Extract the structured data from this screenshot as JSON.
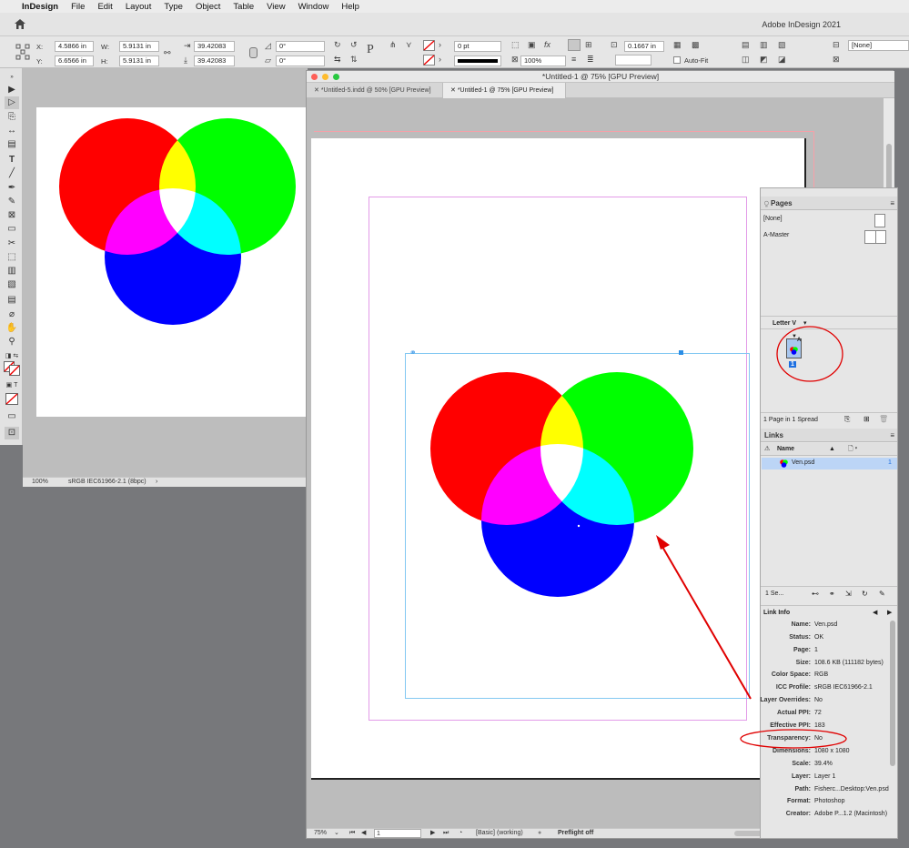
{
  "menubar": {
    "apple": "",
    "app": "InDesign",
    "items": [
      "File",
      "Edit",
      "Layout",
      "Type",
      "Object",
      "Table",
      "View",
      "Window",
      "Help"
    ]
  },
  "appbar": {
    "title": "Adobe InDesign 2021"
  },
  "control": {
    "x_label": "X:",
    "x_value": "4.5866 in",
    "y_label": "Y:",
    "y_value": "6.6566 in",
    "w_label": "W:",
    "w_value": "5.9131 in",
    "h_label": "H:",
    "h_value": "5.9131 in",
    "scale_x": "39.42083",
    "scale_y": "39.42083",
    "rotate": "0°",
    "shear": "0°",
    "stroke_weight": "0 pt",
    "opacity": "100%",
    "fit_value": "0.1667 in",
    "auto_fit": "Auto-Fit",
    "style": "[None]"
  },
  "window1": {
    "zoom": "100%",
    "profile": "sRGB IEC61966-2.1 (8bpc)"
  },
  "window2": {
    "title": "*Untitled-1 @ 75% [GPU Preview]",
    "tabs": [
      "*Untitled-5.indd @ 50% [GPU Preview]",
      "*Untitled-1 @ 75% [GPU Preview]"
    ],
    "zoom": "75%",
    "page": "1",
    "style_state": "[Basic] (working)",
    "preflight": "Preflight off"
  },
  "pages_panel": {
    "title": "Pages",
    "none": "[None]",
    "master": "A-Master",
    "size": "Letter V",
    "page_number": "1",
    "master_letter": "A",
    "summary": "1 Page in 1 Spread"
  },
  "links_panel": {
    "title": "Links",
    "col_name": "Name",
    "file": "Ven.psd",
    "selection": "1 Se...",
    "info_title": "Link Info",
    "info": [
      {
        "k": "Name:",
        "v": "Ven.psd"
      },
      {
        "k": "Status:",
        "v": "OK"
      },
      {
        "k": "Page:",
        "v": "1"
      },
      {
        "k": "Size:",
        "v": "108.6 KB (111182 bytes)"
      },
      {
        "k": "Color Space:",
        "v": "RGB"
      },
      {
        "k": "ICC Profile:",
        "v": "sRGB IEC61966-2.1"
      },
      {
        "k": "Layer Overrides:",
        "v": "No"
      },
      {
        "k": "Actual PPI:",
        "v": "72"
      },
      {
        "k": "Effective PPI:",
        "v": "183"
      },
      {
        "k": "Transparency:",
        "v": "No"
      },
      {
        "k": "Dimensions:",
        "v": "1080 x 1080"
      },
      {
        "k": "Scale:",
        "v": "39.4%"
      },
      {
        "k": "Layer:",
        "v": "Layer 1"
      },
      {
        "k": "Path:",
        "v": "Fisherc...Desktop:Ven.psd"
      },
      {
        "k": "Format:",
        "v": "Photoshop"
      },
      {
        "k": "Creator:",
        "v": "Adobe P...1.2 (Macintosh)"
      }
    ]
  },
  "colors": {
    "red": "#ff0000",
    "green": "#00ff00",
    "blue": "#0000ff",
    "annotation": "#e00000"
  }
}
